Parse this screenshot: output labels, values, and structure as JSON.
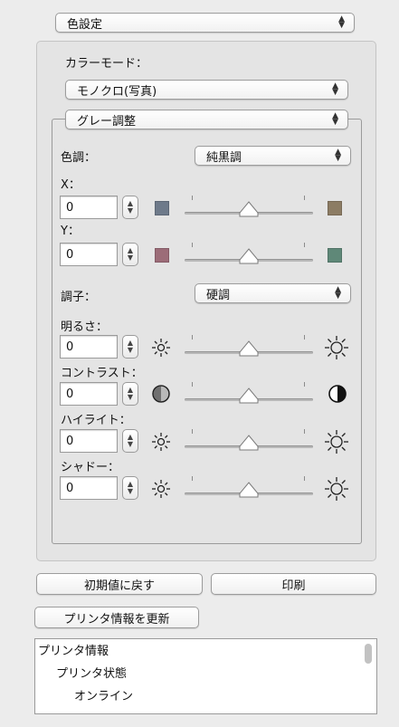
{
  "top_popup": {
    "value": "色設定"
  },
  "color_mode": {
    "label": "カラーモード：",
    "value": "モノクロ(写真)"
  },
  "gray_adjust": {
    "popup_value": "グレー調整",
    "tone": {
      "label": "色調：",
      "value": "純黒調"
    },
    "x": {
      "label": "X：",
      "value": "0",
      "left_color": "#6e7a8a",
      "right_color": "#8c7c64"
    },
    "y": {
      "label": "Y：",
      "value": "0",
      "left_color": "#9c6c78",
      "right_color": "#5f8878"
    },
    "gradation": {
      "label": "調子：",
      "value": "硬調"
    },
    "brightness": {
      "label": "明るさ：",
      "value": "0"
    },
    "contrast": {
      "label": "コントラスト：",
      "value": "0"
    },
    "highlight": {
      "label": "ハイライト：",
      "value": "0"
    },
    "shadow": {
      "label": "シャドー：",
      "value": "0"
    }
  },
  "buttons": {
    "reset": "初期値に戻す",
    "print": "印刷",
    "update_printer_info": "プリンタ情報を更新"
  },
  "printer_info_list": [
    "プリンタ情報",
    "プリンタ状態",
    "オンライン"
  ]
}
